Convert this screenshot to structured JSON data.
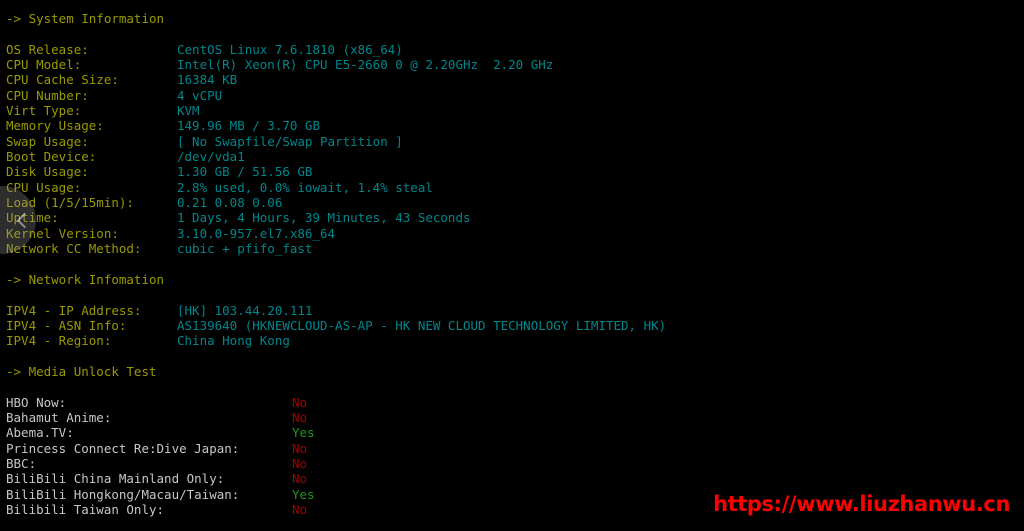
{
  "terminal": {
    "background_color": "#000000",
    "header_color": "#9a9a00",
    "label_color": "#9a9a00",
    "value_color": "#00868b",
    "media_label_color": "#c7c7c7",
    "yes_color": "#1d9a1d",
    "no_color": "#a30000"
  },
  "sections": {
    "system": {
      "heading": "-> System Information",
      "rows": [
        {
          "label": "OS Release:",
          "value": "CentOS Linux 7.6.1810 (x86_64)"
        },
        {
          "label": "CPU Model:",
          "value": "Intel(R) Xeon(R) CPU E5-2660 0 @ 2.20GHz  2.20 GHz"
        },
        {
          "label": "CPU Cache Size:",
          "value": "16384 KB"
        },
        {
          "label": "CPU Number:",
          "value": "4 vCPU"
        },
        {
          "label": "Virt Type:",
          "value": "KVM"
        },
        {
          "label": "Memory Usage:",
          "value": "149.96 MB / 3.70 GB"
        },
        {
          "label": "Swap Usage:",
          "value": "[ No Swapfile/Swap Partition ]"
        },
        {
          "label": "Boot Device:",
          "value": "/dev/vda1"
        },
        {
          "label": "Disk Usage:",
          "value": "1.30 GB / 51.56 GB"
        },
        {
          "label": "CPU Usage:",
          "value": "2.8% used, 0.0% iowait, 1.4% steal"
        },
        {
          "label": "Load (1/5/15min):",
          "value": "0.21 0.08 0.06"
        },
        {
          "label": "Uptime:",
          "value": "1 Days, 4 Hours, 39 Minutes, 43 Seconds"
        },
        {
          "label": "Kernel Version:",
          "value": "3.10.0-957.el7.x86_64"
        },
        {
          "label": "Network CC Method:",
          "value": "cubic + pfifo_fast"
        }
      ]
    },
    "network": {
      "heading": "-> Network Infomation",
      "rows": [
        {
          "label": "IPV4 - IP Address:",
          "value": "[HK] 103.44.20.111"
        },
        {
          "label": "IPV4 - ASN Info:",
          "value": "AS139640 (HKNEWCLOUD-AS-AP - HK NEW CLOUD TECHNOLOGY LIMITED, HK)"
        },
        {
          "label": "IPV4 - Region:",
          "value": "China Hong Kong"
        }
      ]
    },
    "media": {
      "heading": "-> Media Unlock Test",
      "rows": [
        {
          "label": "HBO Now:",
          "value": "No"
        },
        {
          "label": "Bahamut Anime:",
          "value": "No"
        },
        {
          "label": "Abema.TV:",
          "value": "Yes"
        },
        {
          "label": "Princess Connect Re:Dive Japan:",
          "value": "No"
        },
        {
          "label": "BBC:",
          "value": "No"
        },
        {
          "label": "BiliBili China Mainland Only:",
          "value": "No"
        },
        {
          "label": "BiliBili Hongkong/Macau/Taiwan:",
          "value": "Yes"
        },
        {
          "label": "Bilibili Taiwan Only:",
          "value": "No"
        }
      ]
    }
  },
  "overlay": {
    "nav_icon": "chevron-left-icon"
  },
  "watermark": {
    "text": "https://www.liuzhanwu.cn",
    "color": "#ff0000"
  }
}
